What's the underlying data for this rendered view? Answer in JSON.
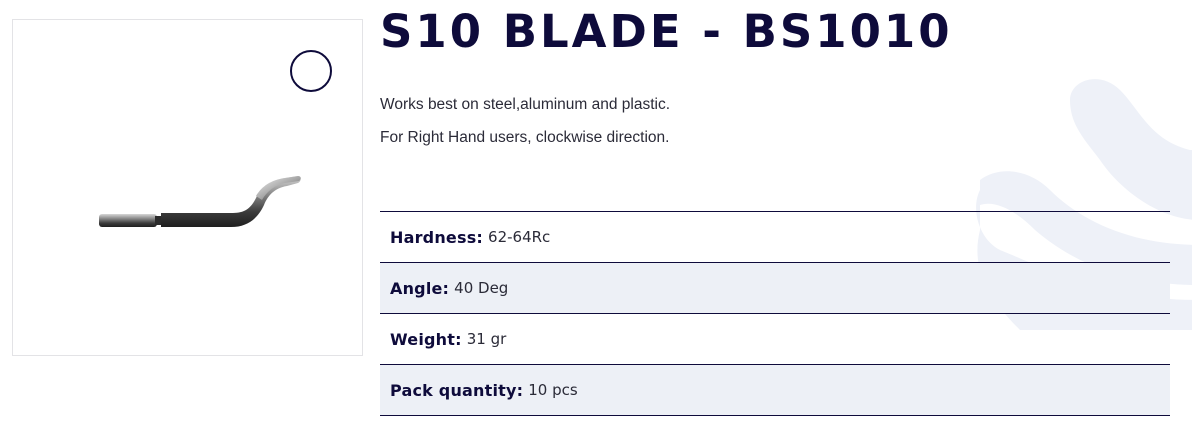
{
  "product": {
    "title": "S10 BLADE - BS1010",
    "description": [
      "Works best on steel,aluminum and plastic.",
      "For Right Hand users, clockwise direction."
    ],
    "image_icon": "deburring-blade-image",
    "zoom_icon": "zoom-circle-icon"
  },
  "specs": [
    {
      "label": "Hardness:",
      "value": "62-64Rc"
    },
    {
      "label": "Angle:",
      "value": "40 Deg"
    },
    {
      "label": "Weight:",
      "value": "31 gr"
    },
    {
      "label": "Pack quantity:",
      "value": "10 pcs"
    }
  ],
  "colors": {
    "brand_navy": "#0e0b3b",
    "row_alt": "#edf0f6",
    "swoosh": "#eef1f8"
  }
}
